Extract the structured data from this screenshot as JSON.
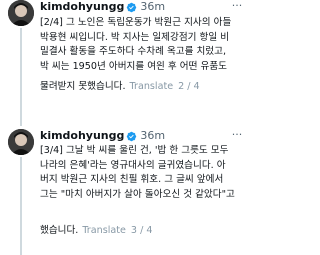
{
  "posts": [
    {
      "username": "kimdohyungg",
      "verified_icon": "verified-badge-icon",
      "time": "36m",
      "more_label": "···",
      "text_lines": [
        "[2/4] 그 노인은 독립운동가 박원근 지사의 아들",
        "박용현 씨입니다. 박 지사는 일제강점기 항일 비",
        "밀결사 활동을 주도하다 수차례 옥고를 치렀고,",
        "박 씨는 1950년 아버지를 여읜 후 어떤 유품도"
      ],
      "last_line_before_translate": "물려받지 못했습니다.",
      "translate_label": "Translate",
      "counter": "2 / 4"
    },
    {
      "username": "kimdohyungg",
      "verified_icon": "verified-badge-icon",
      "time": "36m",
      "more_label": "···",
      "text_lines": [
        "[3/4] 그날 박 씨를 울린 건, '밥 한 그릇도 모두",
        "나라의 은혜'라는 영규대사의 글귀였습니다. 아",
        "버지 박원근 지사의 친필 휘호. 그 글씨 앞에서",
        "그는 \"마치 아버지가 살아 돌아오신 것 같았다\"고",
        "했습니다."
      ],
      "translate_label": "Translate",
      "counter": "3 / 4"
    }
  ],
  "colors": {
    "verified": "#1d9bf0",
    "secondary": "#536471",
    "thread_line": "#cfd9de"
  }
}
